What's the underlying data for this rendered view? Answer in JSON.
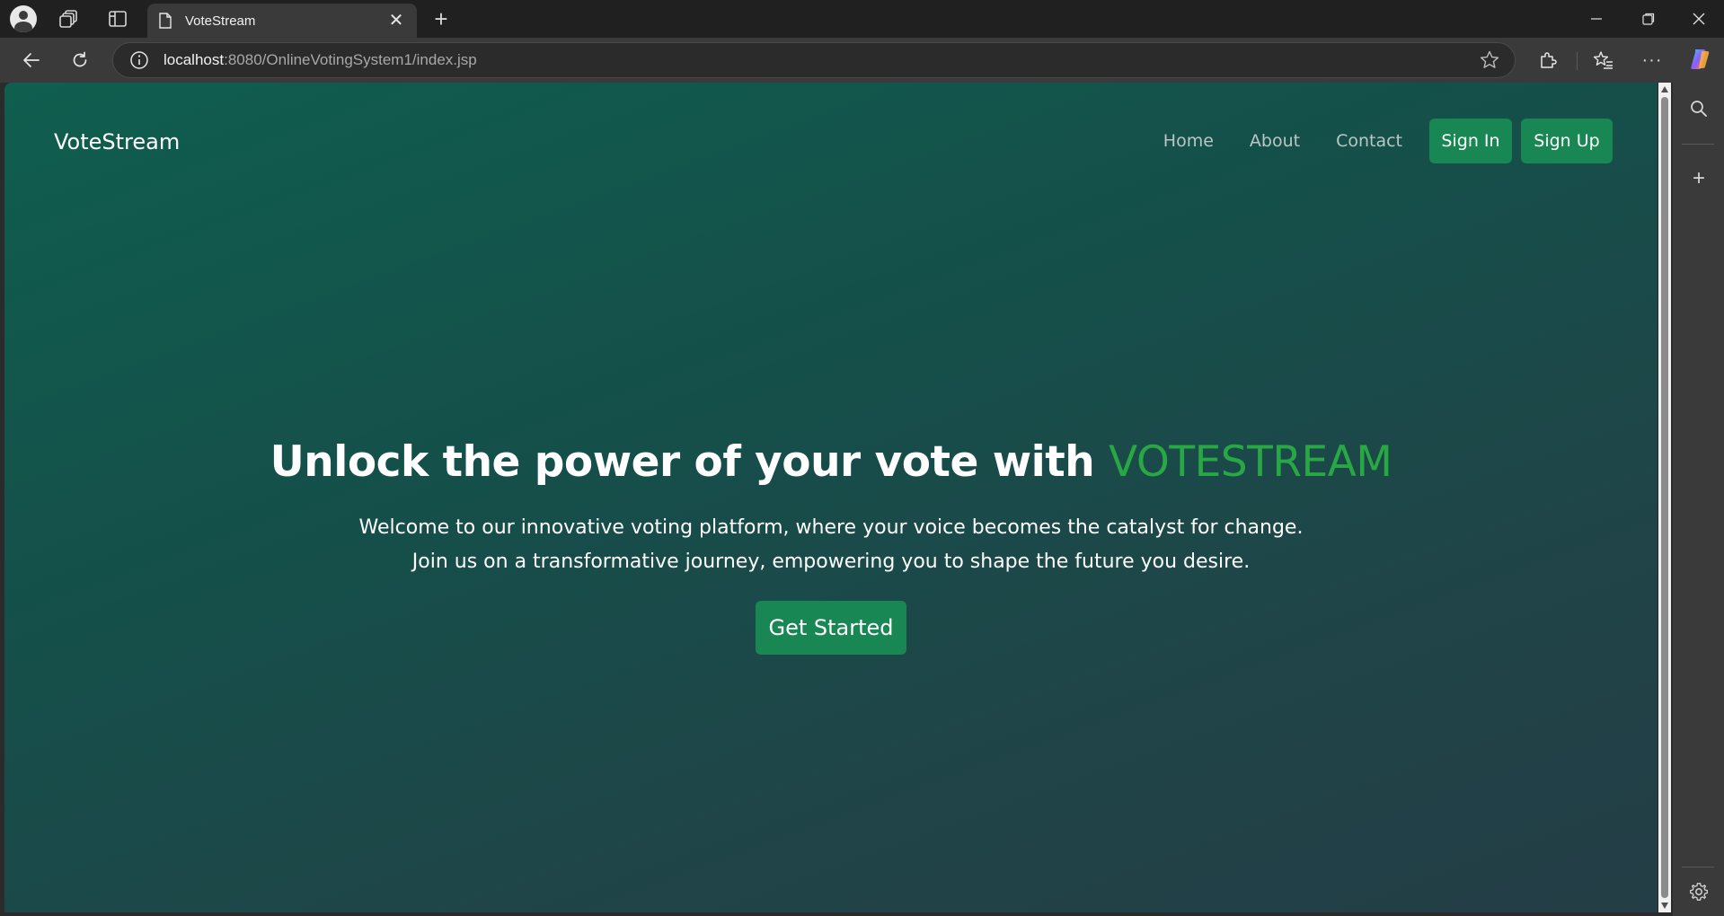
{
  "browser": {
    "tab_title": "VoteStream",
    "url_host": "localhost",
    "url_rest": ":8080/OnlineVotingSystem1/index.jsp",
    "more_label": "···"
  },
  "site": {
    "brand": "VoteStream",
    "nav": {
      "home": "Home",
      "about": "About",
      "contact": "Contact",
      "sign_in": "Sign In",
      "sign_up": "Sign Up"
    },
    "hero": {
      "headline": "Unlock the power of your vote with ",
      "headline_accent": "VOTESTREAM",
      "lead_line1": "Welcome to our innovative voting platform, where your voice becomes the catalyst for change.",
      "lead_line2": "Join us on a transformative journey, empowering you to shape the future you desire.",
      "cta": "Get Started"
    }
  },
  "colors": {
    "accent_green": "#28a745",
    "button_green": "#198754",
    "gradient_start": "#0f5e4e",
    "gradient_end": "#243d46"
  },
  "icons": [
    "profile-icon",
    "workspaces-icon",
    "vertical-tabs-icon",
    "page-icon",
    "close-icon",
    "new-tab-icon",
    "minimize-icon",
    "maximize-icon",
    "close-window-icon",
    "back-icon",
    "reload-icon",
    "info-icon",
    "favorite-star-icon",
    "extensions-icon",
    "favorites-icon",
    "more-icon",
    "copilot-icon",
    "search-icon",
    "add-icon",
    "settings-icon"
  ]
}
